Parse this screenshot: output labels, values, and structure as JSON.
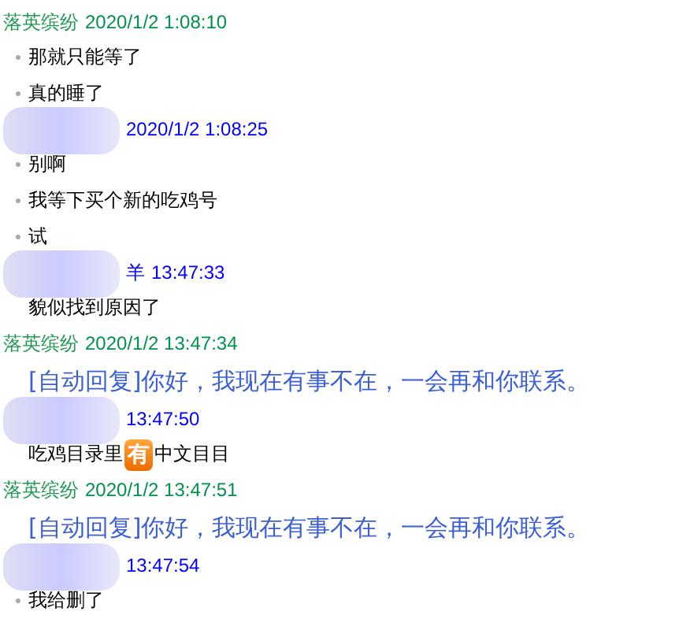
{
  "messages": [
    {
      "sender": "落英缤纷",
      "kind": "self",
      "redacted": false,
      "time": "2020/1/2 1:08:10",
      "lines": [
        {
          "kind": "text",
          "bullet": true,
          "parts": [
            {
              "text": "那就只能等了"
            }
          ]
        },
        {
          "kind": "text",
          "bullet": true,
          "parts": [
            {
              "text": "真的睡了"
            }
          ]
        }
      ]
    },
    {
      "kind": "other",
      "redacted": true,
      "time": "2020/1/2 1:08:25",
      "lines": [
        {
          "kind": "text",
          "bullet": true,
          "parts": [
            {
              "text": "别啊"
            }
          ]
        },
        {
          "kind": "text",
          "bullet": true,
          "parts": [
            {
              "text": "我等下买个新的吃鸡号"
            }
          ]
        },
        {
          "kind": "text",
          "bullet": true,
          "parts": [
            {
              "text": "试"
            }
          ]
        }
      ]
    },
    {
      "sender": "羊",
      "kind": "other",
      "redacted": true,
      "time": "13:47:33",
      "lines": [
        {
          "kind": "text",
          "bullet": false,
          "parts": [
            {
              "text": "貌似找到原因了"
            }
          ]
        }
      ]
    },
    {
      "sender": "落英缤纷",
      "kind": "self",
      "redacted": false,
      "time": "2020/1/2 13:47:34",
      "lines": [
        {
          "kind": "auto",
          "bullet": false,
          "parts": [
            {
              "text": "[自动回复]你好，我现在有事不在，一会再和你联系。"
            }
          ]
        }
      ]
    },
    {
      "kind": "other",
      "redacted": true,
      "time": "13:47:50",
      "lines": [
        {
          "kind": "text",
          "bullet": false,
          "parts": [
            {
              "text": "吃鸡目录里"
            },
            {
              "text": "有",
              "kind": "badge"
            },
            {
              "text": "中文目目"
            }
          ]
        }
      ]
    },
    {
      "sender": "落英缤纷",
      "kind": "self",
      "redacted": false,
      "time": "2020/1/2 13:47:51",
      "lines": [
        {
          "kind": "auto",
          "bullet": false,
          "parts": [
            {
              "text": "[自动回复]你好，我现在有事不在，一会再和你联系。"
            }
          ]
        }
      ]
    },
    {
      "kind": "other",
      "redacted": true,
      "time": "13:47:54",
      "lines": [
        {
          "kind": "text",
          "bullet": true,
          "parts": [
            {
              "text": "我给删了"
            }
          ]
        }
      ]
    }
  ]
}
